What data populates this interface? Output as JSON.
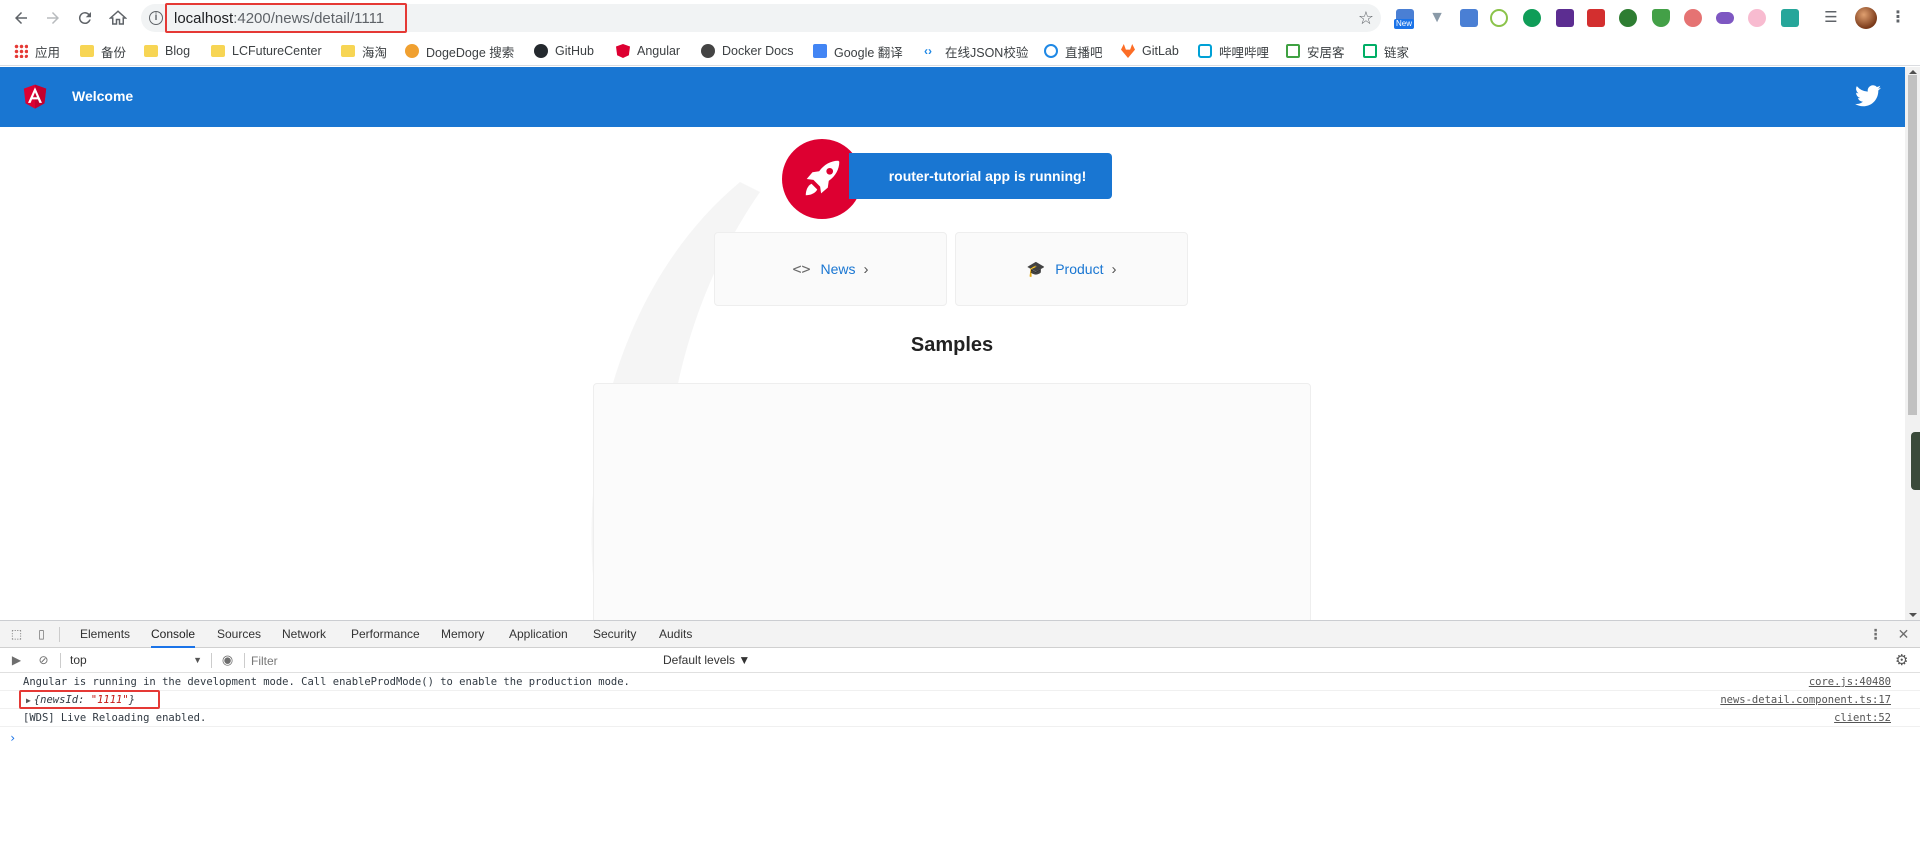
{
  "browser": {
    "url_host": "localhost",
    "url_path": ":4200/news/detail/1111",
    "bookmarks": [
      {
        "label": "应用"
      },
      {
        "label": "备份"
      },
      {
        "label": "Blog"
      },
      {
        "label": "LCFutureCenter"
      },
      {
        "label": "海淘"
      },
      {
        "label": "DogeDoge 搜索"
      },
      {
        "label": "GitHub"
      },
      {
        "label": "Angular"
      },
      {
        "label": "Docker Docs"
      },
      {
        "label": "Google 翻译"
      },
      {
        "label": "在线JSON校验"
      },
      {
        "label": "直播吧"
      },
      {
        "label": "GitLab"
      },
      {
        "label": "哔哩哔哩"
      },
      {
        "label": "安居客"
      },
      {
        "label": "链家"
      }
    ],
    "extension_badge": "New"
  },
  "app": {
    "title": "Welcome",
    "banner": "router-tutorial app is running!",
    "cards": [
      {
        "label": "News"
      },
      {
        "label": "Product"
      }
    ],
    "samples_heading": "Samples",
    "colors": {
      "header": "#1976d2",
      "rocket": "#dd0031"
    }
  },
  "devtools": {
    "tabs": [
      "Elements",
      "Console",
      "Sources",
      "Network",
      "Performance",
      "Memory",
      "Application",
      "Security",
      "Audits"
    ],
    "active_tab": "Console",
    "context": "top",
    "filter_placeholder": "Filter",
    "levels": "Default levels ▼",
    "messages": [
      {
        "text": "Angular is running in the development mode. Call enableProdMode() to enable the production mode.",
        "source": "core.js:40480"
      },
      {
        "object_key": "newsId",
        "object_value": "\"1111\"",
        "source": "news-detail.component.ts:17"
      },
      {
        "text": "[WDS] Live Reloading enabled.",
        "source": "client:52"
      }
    ],
    "prompt": "›"
  }
}
